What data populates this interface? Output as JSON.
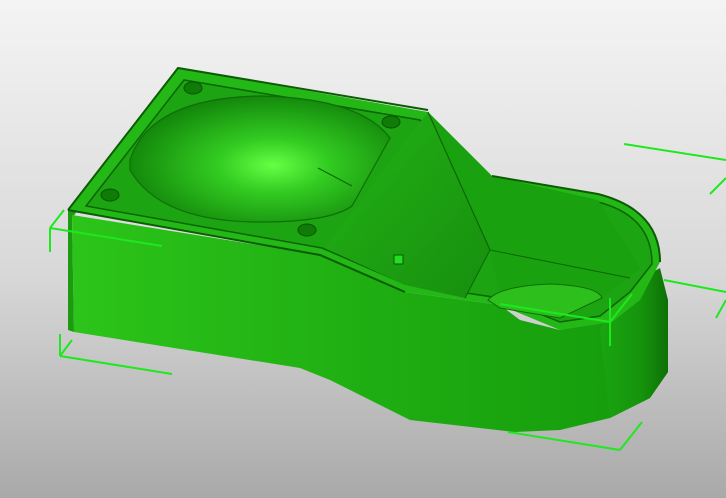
{
  "viewport": {
    "background_top": "#f4f4f4",
    "background_bottom": "#a9a9a9"
  },
  "model": {
    "color_main": "#22b014",
    "color_light": "#39d225",
    "color_dark": "#0f7a08",
    "color_highlight": "#6aff4a",
    "selected": true
  },
  "bounding_box": {
    "color": "#1ee81e"
  },
  "selection_handle": {
    "color": "#22dd22"
  },
  "icons": [
    "selection-handle-icon"
  ]
}
